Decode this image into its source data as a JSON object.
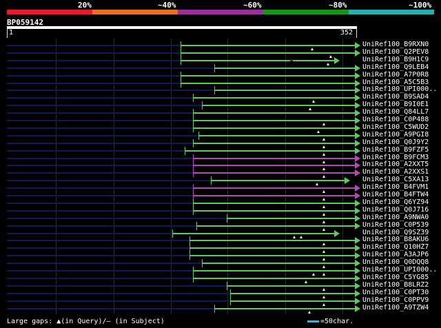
{
  "legend": {
    "labels": [
      "20%",
      "~40%",
      "~60%",
      "~80%",
      "~100%"
    ],
    "segment_colors": [
      "#e31b2b",
      "#e77123",
      "#9a2f9c",
      "#15961b",
      "#23b0b0"
    ]
  },
  "query": {
    "id": "BP059142",
    "start": "1",
    "end": "352"
  },
  "colors": {
    "green": "#5ec95e",
    "purple": "#b44ab8",
    "navy": "#0d1a5a",
    "gap_marker": "#ffff66"
  },
  "hits": [
    {
      "label": "UniRef100_B9RXN0",
      "start": 0.497,
      "end": 0.995,
      "color": "green",
      "gaps": [
        0.872
      ],
      "subject_gaps": []
    },
    {
      "label": "UniRef100_Q2PEV8",
      "start": 0.497,
      "end": 0.995,
      "color": "green",
      "gaps": [
        0.925
      ],
      "subject_gaps": []
    },
    {
      "label": "UniRef100_B9H1C9",
      "start": 0.497,
      "end": 0.935,
      "color": "green",
      "gaps": [
        0.918
      ],
      "subject_gaps": [
        0.81
      ]
    },
    {
      "label": "UniRef100_Q9LEB4",
      "start": 0.592,
      "end": 0.995,
      "color": "green",
      "gaps": [],
      "subject_gaps": []
    },
    {
      "label": "UniRef100_A7P0R8",
      "start": 0.497,
      "end": 0.995,
      "color": "green",
      "gaps": [],
      "subject_gaps": []
    },
    {
      "label": "UniRef100_A5C5B3",
      "start": 0.497,
      "end": 0.995,
      "color": "green",
      "gaps": [],
      "subject_gaps": []
    },
    {
      "label": "UniRef100_UPI000..",
      "start": 0.592,
      "end": 0.995,
      "color": "green",
      "gaps": [],
      "subject_gaps": []
    },
    {
      "label": "UniRef100_B9SAD4",
      "start": 0.532,
      "end": 0.995,
      "color": "green",
      "gaps": [
        0.875
      ],
      "subject_gaps": []
    },
    {
      "label": "UniRef100_B9I0E1",
      "start": 0.557,
      "end": 0.995,
      "color": "green",
      "gaps": [
        0.867
      ],
      "subject_gaps": []
    },
    {
      "label": "UniRef100_Q84LL7",
      "start": 0.532,
      "end": 0.995,
      "color": "green",
      "gaps": [],
      "subject_gaps": []
    },
    {
      "label": "UniRef100_C0P488",
      "start": 0.532,
      "end": 0.995,
      "color": "green",
      "gaps": [
        0.905
      ],
      "subject_gaps": []
    },
    {
      "label": "UniRef100_C5WUD2",
      "start": 0.532,
      "end": 0.995,
      "color": "green",
      "gaps": [
        0.89
      ],
      "subject_gaps": []
    },
    {
      "label": "UniRef100_A9PGI8",
      "start": 0.547,
      "end": 0.995,
      "color": "green",
      "gaps": [
        0.905
      ],
      "subject_gaps": []
    },
    {
      "label": "UniRef100_Q0J9Y2",
      "start": 0.532,
      "end": 0.995,
      "color": "green",
      "gaps": [
        0.905
      ],
      "subject_gaps": []
    },
    {
      "label": "UniRef100_B9FZF5",
      "start": 0.507,
      "end": 0.995,
      "color": "green",
      "gaps": [
        0.905
      ],
      "subject_gaps": []
    },
    {
      "label": "UniRef100_B9FCM3",
      "start": 0.532,
      "end": 0.995,
      "color": "purple",
      "gaps": [
        0.905
      ],
      "subject_gaps": []
    },
    {
      "label": "UniRef100_A2XXT5",
      "start": 0.532,
      "end": 0.995,
      "color": "purple",
      "gaps": [
        0.905
      ],
      "subject_gaps": []
    },
    {
      "label": "UniRef100_A2XXS1",
      "start": 0.532,
      "end": 0.995,
      "color": "purple",
      "gaps": [
        0.905
      ],
      "subject_gaps": []
    },
    {
      "label": "UniRef100_C5XA13",
      "start": 0.582,
      "end": 0.965,
      "color": "green",
      "gaps": [
        0.885
      ],
      "subject_gaps": []
    },
    {
      "label": "UniRef100_B4FVM1",
      "start": 0.532,
      "end": 0.995,
      "color": "purple",
      "gaps": [
        0.905
      ],
      "subject_gaps": []
    },
    {
      "label": "UniRef100_B4FTW4",
      "start": 0.532,
      "end": 0.995,
      "color": "purple",
      "gaps": [
        0.905
      ],
      "subject_gaps": []
    },
    {
      "label": "UniRef100_Q6YZ94",
      "start": 0.532,
      "end": 0.995,
      "color": "green",
      "gaps": [
        0.905
      ],
      "subject_gaps": []
    },
    {
      "label": "UniRef100_Q0J716",
      "start": 0.532,
      "end": 0.995,
      "color": "green",
      "gaps": [
        0.905
      ],
      "subject_gaps": []
    },
    {
      "label": "UniRef100_A9NWA0",
      "start": 0.627,
      "end": 0.995,
      "color": "green",
      "gaps": [
        0.905
      ],
      "subject_gaps": []
    },
    {
      "label": "UniRef100_C0P539",
      "start": 0.542,
      "end": 0.995,
      "color": "green",
      "gaps": [
        0.905
      ],
      "subject_gaps": []
    },
    {
      "label": "UniRef100_Q9SZ39",
      "start": 0.472,
      "end": 0.935,
      "color": "green",
      "gaps": [
        0.82,
        0.84
      ],
      "subject_gaps": []
    },
    {
      "label": "UniRef100_B8AKU6",
      "start": 0.522,
      "end": 0.995,
      "color": "green",
      "gaps": [
        0.905
      ],
      "subject_gaps": []
    },
    {
      "label": "UniRef100_Q10HZ7",
      "start": 0.522,
      "end": 0.995,
      "color": "green",
      "gaps": [
        0.905
      ],
      "subject_gaps": []
    },
    {
      "label": "UniRef100_A3AJP6",
      "start": 0.522,
      "end": 0.995,
      "color": "green",
      "gaps": [
        0.905
      ],
      "subject_gaps": []
    },
    {
      "label": "UniRef100_Q0DQQ8",
      "start": 0.557,
      "end": 0.995,
      "color": "green",
      "gaps": [
        0.905
      ],
      "subject_gaps": []
    },
    {
      "label": "UniRef100_UPI000..",
      "start": 0.532,
      "end": 0.995,
      "color": "green",
      "gaps": [
        0.875,
        0.905
      ],
      "subject_gaps": []
    },
    {
      "label": "UniRef100_C5YG85",
      "start": 0.532,
      "end": 0.995,
      "color": "green",
      "gaps": [
        0.855
      ],
      "subject_gaps": []
    },
    {
      "label": "UniRef100_B8LRZ2",
      "start": 0.627,
      "end": 0.995,
      "color": "green",
      "gaps": [
        0.905
      ],
      "subject_gaps": []
    },
    {
      "label": "UniRef100_C0PT30",
      "start": 0.637,
      "end": 0.995,
      "color": "green",
      "gaps": [
        0.905
      ],
      "subject_gaps": []
    },
    {
      "label": "UniRef100_C0PPV9",
      "start": 0.637,
      "end": 0.995,
      "color": "green",
      "gaps": [
        0.905
      ],
      "subject_gaps": []
    },
    {
      "label": "UniRef100_A9TZW4",
      "start": 0.592,
      "end": 0.995,
      "color": "green",
      "gaps": [
        0.865
      ],
      "subject_gaps": []
    }
  ],
  "footer": {
    "text": "Large gaps: ▲(in Query)/– (in Subject)",
    "scale_text": "=50char."
  }
}
